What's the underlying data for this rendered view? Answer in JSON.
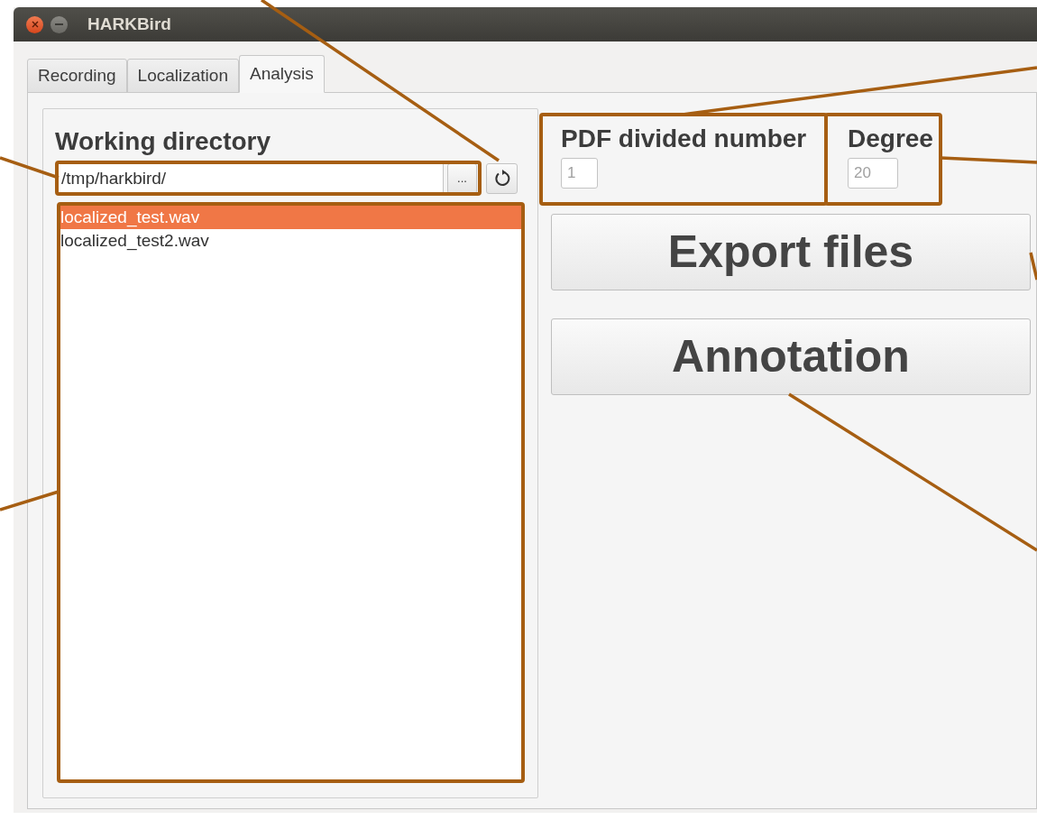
{
  "window": {
    "title": "HARKBird"
  },
  "tabs": [
    {
      "label": "Recording",
      "selected": false
    },
    {
      "label": "Localization",
      "selected": false
    },
    {
      "label": "Analysis",
      "selected": true
    }
  ],
  "working_directory": {
    "title": "Working directory",
    "path": "/tmp/harkbird/",
    "browse_button": "...",
    "files": [
      {
        "name": "localized_test.wav",
        "selected": true
      },
      {
        "name": "localized_test2.wav",
        "selected": false
      }
    ]
  },
  "pdf_divided_number": {
    "label": "PDF divided number",
    "value": "1",
    "disabled": true
  },
  "degree": {
    "label": "Degree",
    "value": "20",
    "disabled": true
  },
  "buttons": [
    "Export files",
    "Annotation"
  ]
}
